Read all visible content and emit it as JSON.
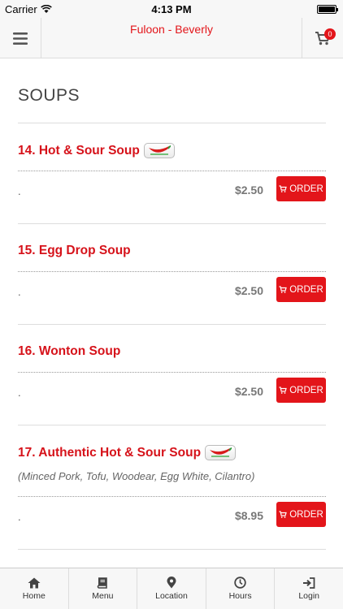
{
  "status_bar": {
    "carrier": "Carrier",
    "time": "4:13 PM"
  },
  "nav": {
    "title": "Fuloon - Beverly",
    "cart_count": "0"
  },
  "section": {
    "title": "SOUPS"
  },
  "items": [
    {
      "name": "14. Hot & Sour Soup",
      "spicy": true,
      "description": "",
      "dot": ".",
      "price": "$2.50",
      "order_label": "ORDER"
    },
    {
      "name": "15. Egg Drop Soup",
      "spicy": false,
      "description": "",
      "dot": ".",
      "price": "$2.50",
      "order_label": "ORDER"
    },
    {
      "name": "16. Wonton Soup",
      "spicy": false,
      "description": "",
      "dot": ".",
      "price": "$2.50",
      "order_label": "ORDER"
    },
    {
      "name": "17. Authentic Hot & Sour Soup",
      "spicy": true,
      "description": "(Minced Pork, Tofu, Woodear, Egg White, Cilantro)",
      "dot": ".",
      "price": "$8.95",
      "order_label": "ORDER"
    }
  ],
  "tabs": [
    {
      "label": "Home",
      "icon": "home-icon"
    },
    {
      "label": "Menu",
      "icon": "book-icon"
    },
    {
      "label": "Location",
      "icon": "map-pin-icon"
    },
    {
      "label": "Hours",
      "icon": "clock-icon"
    },
    {
      "label": "Login",
      "icon": "login-icon"
    }
  ],
  "colors": {
    "accent": "#e3151a",
    "item_name": "#d6121a",
    "bar_bg": "#f7f7f7"
  }
}
